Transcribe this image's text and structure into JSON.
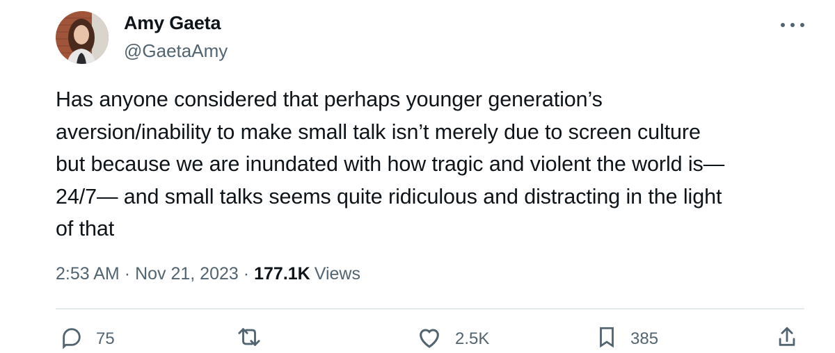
{
  "tweet": {
    "author": {
      "display_name": "Amy Gaeta",
      "handle": "@GaetaAmy"
    },
    "text": "Has anyone considered that perhaps younger generation’s\naversion/inability to make small talk isn’t merely due to screen culture\nbut because we are inundated with how tragic and violent the world is—\n24/7— and small talks seems quite ridiculous and distracting in the light\nof that",
    "time": "2:53 AM",
    "separator": "·",
    "date": "Nov 21, 2023",
    "views_count": "177.1K",
    "views_label": "Views"
  },
  "actions": {
    "reply": {
      "icon": "reply-icon",
      "count": "75"
    },
    "retweet": {
      "icon": "retweet-icon",
      "count": ""
    },
    "like": {
      "icon": "heart-icon",
      "count": "2.5K"
    },
    "bookmark": {
      "icon": "bookmark-icon",
      "count": "385"
    },
    "share": {
      "icon": "share-icon",
      "count": ""
    }
  },
  "colors": {
    "text_primary": "#0f1419",
    "text_secondary": "#536471",
    "divider": "#cfd9de"
  }
}
